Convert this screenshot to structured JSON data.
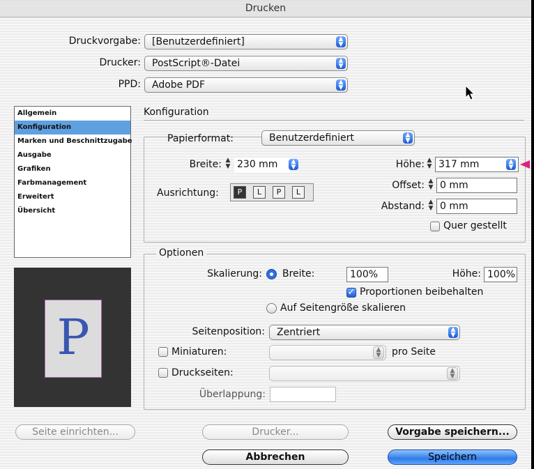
{
  "window": {
    "title": "Drucken"
  },
  "top": {
    "preset_label": "Druckvorgabe:",
    "preset_value": "[Benutzerdefiniert]",
    "printer_label": "Drucker:",
    "printer_value": "PostScript®-Datei",
    "ppd_label": "PPD:",
    "ppd_value": "Adobe PDF"
  },
  "sidebar": {
    "items": [
      {
        "label": "Allgemein"
      },
      {
        "label": "Konfiguration"
      },
      {
        "label": "Marken und Beschnittzugabe"
      },
      {
        "label": "Ausgabe"
      },
      {
        "label": "Grafiken"
      },
      {
        "label": "Farbmanagement"
      },
      {
        "label": "Erweitert"
      },
      {
        "label": "Übersicht"
      }
    ],
    "selected": "Konfiguration"
  },
  "preview": {
    "letter": "P"
  },
  "config": {
    "heading": "Konfiguration",
    "paper_label": "Papierformat:",
    "paper_value": "Benutzerdefiniert",
    "width_label": "Breite:",
    "width_value": "230 mm",
    "height_label": "Höhe:",
    "height_value": "317 mm",
    "offset_label": "Offset:",
    "offset_value": "0 mm",
    "gap_label": "Abstand:",
    "gap_value": "0 mm",
    "orientation_label": "Ausrichtung:",
    "orientation_buttons": [
      "P",
      "L",
      "P",
      "L"
    ],
    "transverse_label": "Quer gestellt"
  },
  "options": {
    "heading": "Optionen",
    "scale_label": "Skalierung:",
    "scale_width_label": "Breite:",
    "scale_width_value": "100%",
    "scale_height_label": "Höhe:",
    "scale_height_value": "100%",
    "proportions_label": "Proportionen beibehalten",
    "fit_label": "Auf Seitengröße skalieren",
    "position_label": "Seitenposition:",
    "position_value": "Zentriert",
    "thumbnails_label": "Miniaturen:",
    "per_page_label": "pro Seite",
    "tile_label": "Druckseiten:",
    "overlap_label": "Überlappung:"
  },
  "buttons": {
    "page_setup": "Seite einrichten...",
    "printer": "Drucker...",
    "save_preset": "Vorgabe speichern...",
    "cancel": "Abbrechen",
    "save": "Speichern"
  },
  "colors": {
    "accent": "#2f7be8",
    "selection": "#5fa0e0",
    "annotation_arrow": "#e0207a"
  },
  "icons": {
    "cursor": "cursor-arrow-icon",
    "popup": "updown-arrows-icon",
    "stepper": "stepper-icon"
  }
}
